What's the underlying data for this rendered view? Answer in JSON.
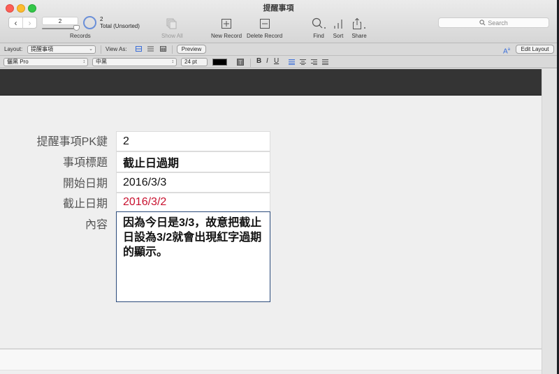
{
  "window": {
    "title": "提醒事項"
  },
  "toolbar": {
    "record_number": "2",
    "records_label": "Records",
    "total_count": "2",
    "total_label": "Total (Unsorted)",
    "show_all_label": "Show All",
    "new_record_label": "New Record",
    "delete_record_label": "Delete Record",
    "find_label": "Find",
    "sort_label": "Sort",
    "share_label": "Share",
    "search_placeholder": "Search"
  },
  "layout_bar": {
    "layout_label": "Layout:",
    "layout_value": "提醒事項",
    "view_as_label": "View As:",
    "view_modes": [
      "form",
      "list",
      "table"
    ],
    "active_view": "form",
    "preview_label": "Preview",
    "edit_layout_label": "Edit Layout",
    "accent_color": "#3b6fd9"
  },
  "format_bar": {
    "font": "儷黑 Pro",
    "style": "中黑",
    "size": "24 pt",
    "text_color": "#000000",
    "bold": "B",
    "italic": "I",
    "underline": "U",
    "alignments": [
      "left",
      "center",
      "right",
      "justify"
    ],
    "active_alignment": "left"
  },
  "record": {
    "fields": [
      {
        "label": "提醒事項PK鍵",
        "value": "2"
      },
      {
        "label": "事項標題",
        "value": "截止日過期"
      },
      {
        "label": "開始日期",
        "value": "2016/3/3"
      },
      {
        "label": "截止日期",
        "value": "2016/3/2"
      },
      {
        "label": "內容",
        "value": "因為今日是3/3，故意把截止日設為3/2就會出現紅字過期的顯示。"
      }
    ],
    "overdue_color": "#c8102e"
  }
}
